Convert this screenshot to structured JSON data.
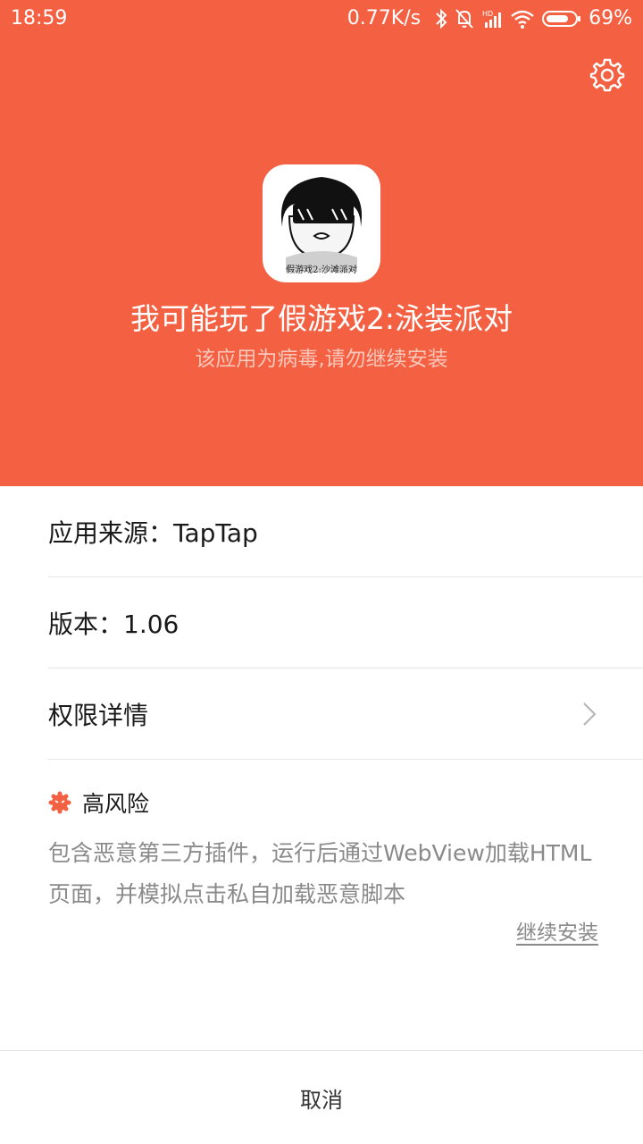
{
  "status_bar": {
    "time": "18:59",
    "network_speed": "0.77K/s",
    "battery_percent": "69%",
    "icons": [
      "bluetooth-icon",
      "mute-icon",
      "hd-signal-icon",
      "wifi-icon",
      "battery-icon"
    ]
  },
  "header": {
    "settings_icon": "gear-icon",
    "app_icon_caption": "假游戏2:沙滩派对",
    "app_name": "我可能玩了假游戏2:泳装派对",
    "warning": "该应用为病毒,请勿继续安装",
    "background_color": "#f46042"
  },
  "details": {
    "source": "应用来源：TapTap",
    "version": "版本：1.06",
    "permissions": "权限详情"
  },
  "risk": {
    "level": "高风险",
    "description": "包含恶意第三方插件，运行后通过WebView加载HTML页面，并模拟点击私自加载恶意脚本",
    "icon": "risk-bug-icon",
    "icon_color": "#f46042"
  },
  "actions": {
    "continue_install": "继续安装",
    "cancel": "取消"
  }
}
